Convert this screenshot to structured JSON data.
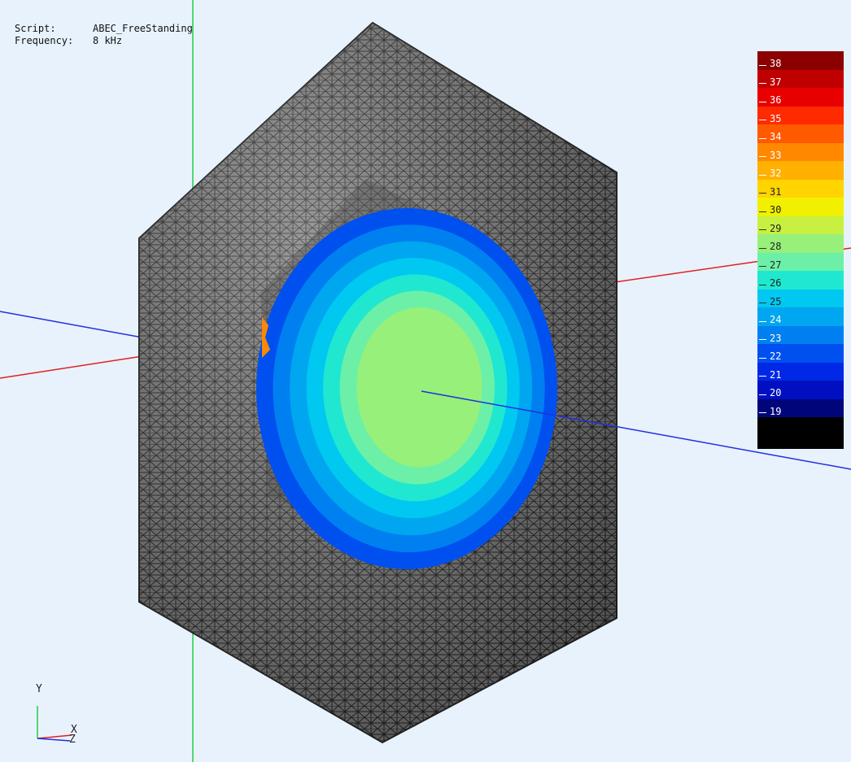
{
  "info": {
    "script_label": "Script:",
    "script_value": "ABEC_FreeStanding",
    "frequency_label": "Frequency:",
    "frequency_value": "8 kHz"
  },
  "legend": {
    "levels": [
      "38",
      "37",
      "36",
      "35",
      "34",
      "33",
      "32",
      "31",
      "30",
      "29",
      "28",
      "27",
      "26",
      "25",
      "24",
      "23",
      "22",
      "21",
      "20",
      "19"
    ],
    "colors": [
      "#8b0000",
      "#c00000",
      "#e80000",
      "#ff2a00",
      "#ff5a00",
      "#ff8800",
      "#ffb000",
      "#ffd400",
      "#f0f000",
      "#c8f040",
      "#96f07a",
      "#6cf0a8",
      "#20e8d0",
      "#00c8f0",
      "#00a6f0",
      "#0080f0",
      "#0050f0",
      "#0028e6",
      "#0010c0",
      "#00067a"
    ],
    "bottom_color": "#000000"
  },
  "contours": [
    "#0050f0",
    "#0080f0",
    "#00a6f0",
    "#00c8f0",
    "#20e8d0",
    "#6cf0a8",
    "#96f07a"
  ],
  "axis_colors": {
    "x": "#e02020",
    "y": "#20d040",
    "z": "#2030e0"
  },
  "triad": {
    "x_label": "X",
    "y_label": "Y",
    "z_label": "Z"
  },
  "mesh_color": "#3a3a3a"
}
